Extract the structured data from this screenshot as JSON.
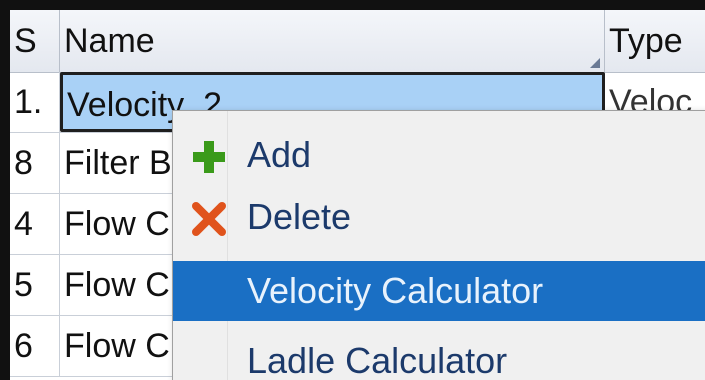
{
  "grid": {
    "headers": {
      "s": "S",
      "name": "Name",
      "type": "Type"
    },
    "rows": [
      {
        "s": "1.",
        "name": "Velocity_2",
        "type": "Veloc"
      },
      {
        "s": "8",
        "name": "Filter B",
        "type": ""
      },
      {
        "s": "4",
        "name": "Flow C",
        "type": ""
      },
      {
        "s": "5",
        "name": "Flow C",
        "type": ""
      },
      {
        "s": "6",
        "name": "Flow C",
        "type": ""
      }
    ]
  },
  "context_menu": {
    "items": [
      {
        "label": "Add",
        "icon": "plus-icon"
      },
      {
        "label": "Delete",
        "icon": "x-icon"
      },
      {
        "label": "Velocity Calculator",
        "icon": ""
      },
      {
        "label": "Ladle Calculator",
        "icon": ""
      }
    ],
    "highlighted_index": 2
  },
  "colors": {
    "selection": "#a9d1f6",
    "menu_highlight": "#1a6fc4",
    "add_icon": "#3a9a1a",
    "delete_icon": "#e0531c"
  }
}
